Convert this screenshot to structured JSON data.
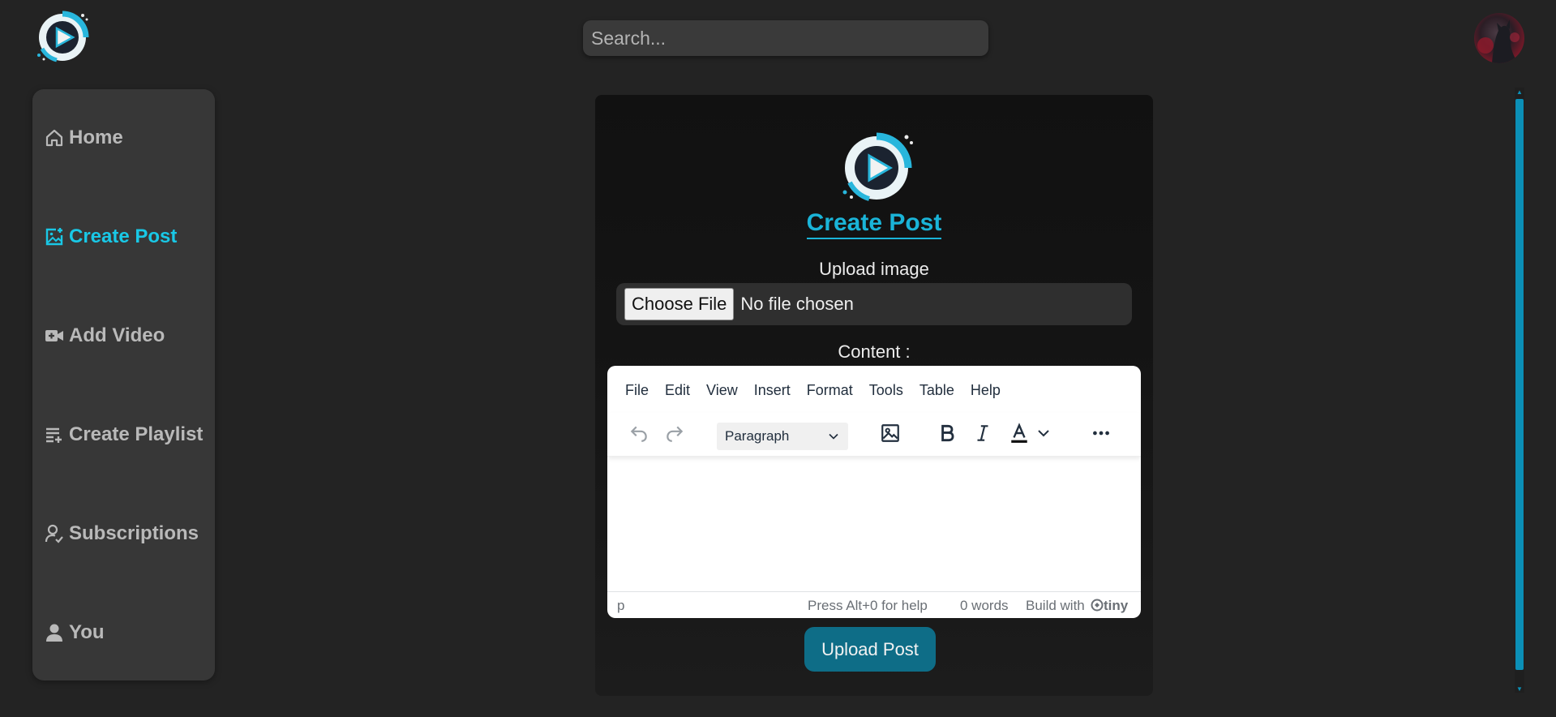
{
  "header": {
    "search_placeholder": "Search...",
    "logo_icon": "play-logo-icon",
    "avatar_icon": "user-avatar"
  },
  "sidebar": {
    "items": [
      {
        "label": "Home",
        "icon": "home-icon",
        "active": false
      },
      {
        "label": "Create Post",
        "icon": "image-plus-icon",
        "active": true
      },
      {
        "label": "Add Video",
        "icon": "video-plus-icon",
        "active": false
      },
      {
        "label": "Create Playlist",
        "icon": "playlist-add-icon",
        "active": false
      },
      {
        "label": "Subscriptions",
        "icon": "user-check-icon",
        "active": false
      },
      {
        "label": "You",
        "icon": "user-icon",
        "active": false
      }
    ]
  },
  "form": {
    "title": "Create Post",
    "upload_label": "Upload image",
    "choose_file_label": "Choose File",
    "file_status": "No file chosen",
    "content_label": "Content :",
    "submit_label": "Upload Post"
  },
  "editor": {
    "menu": [
      "File",
      "Edit",
      "View",
      "Insert",
      "Format",
      "Tools",
      "Table",
      "Help"
    ],
    "block_format": "Paragraph",
    "status_path": "p",
    "status_help": "Press Alt+0 for help",
    "status_words": "0 words",
    "status_build": "Build with",
    "status_brand": "tiny"
  },
  "colors": {
    "accent": "#19c8e6",
    "button": "#0e6d87",
    "background": "#232323",
    "sidebar": "#373737"
  }
}
